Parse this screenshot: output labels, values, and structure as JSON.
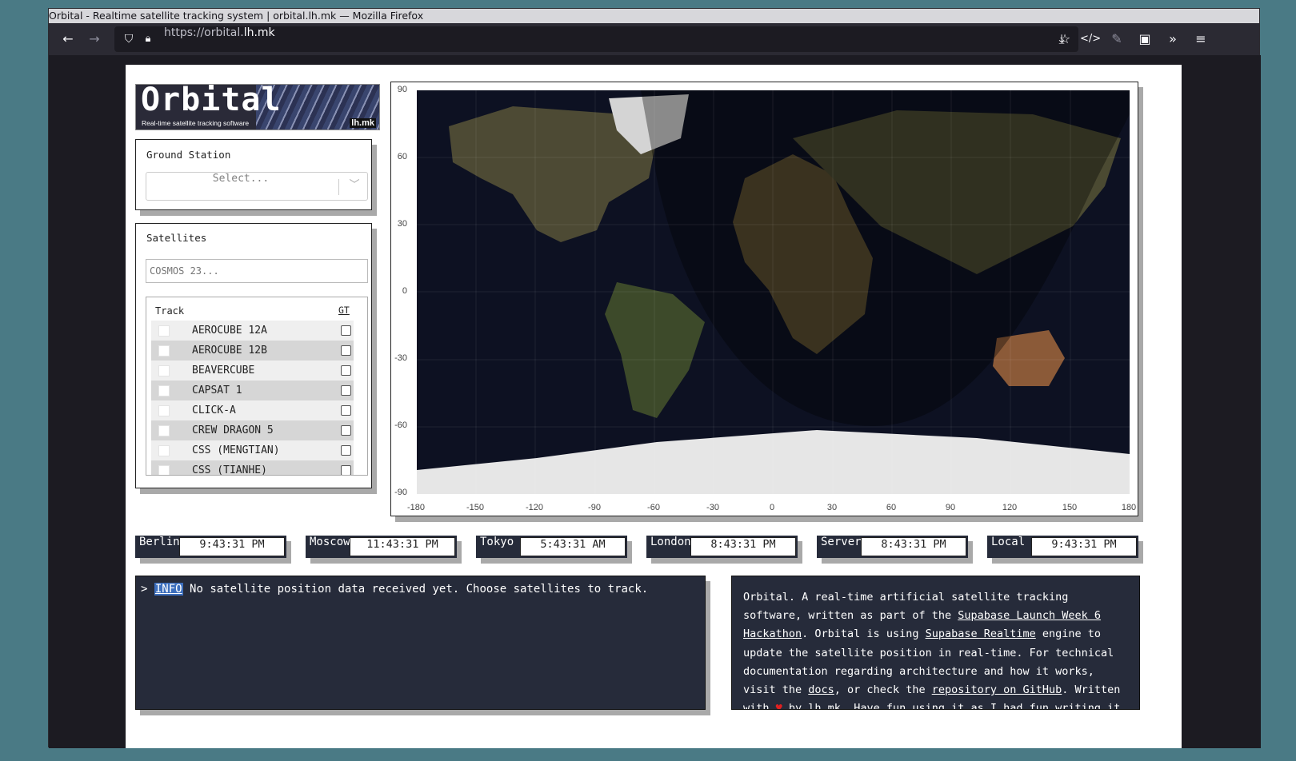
{
  "window": {
    "title": "Orbital - Realtime satellite tracking system | orbital.lh.mk — Mozilla Firefox",
    "url_prefix": "https://orbital.",
    "url_domain": "lh.mk"
  },
  "logo": {
    "title": "Orbital",
    "subtitle": "Real-time satellite tracking software",
    "tag": "lh.mk"
  },
  "ground_station": {
    "label": "Ground Station",
    "placeholder": "Select..."
  },
  "satellites": {
    "label": "Satellites",
    "search_placeholder": "COSMOS 23...",
    "col_track": "Track",
    "col_gt": "GT",
    "rows": [
      {
        "name": "AEROCUBE 12A"
      },
      {
        "name": "AEROCUBE 12B"
      },
      {
        "name": "BEAVERCUBE"
      },
      {
        "name": "CAPSAT 1"
      },
      {
        "name": "CLICK-A"
      },
      {
        "name": "CREW DRAGON 5"
      },
      {
        "name": "CSS (MENGTIAN)"
      },
      {
        "name": "CSS (TIANHE)"
      }
    ]
  },
  "map": {
    "y_ticks": [
      "90",
      "60",
      "30",
      "0",
      "-30",
      "-60",
      "-90"
    ],
    "x_ticks": [
      "-180",
      "-150",
      "-120",
      "-90",
      "-60",
      "-30",
      "0",
      "30",
      "60",
      "90",
      "120",
      "150",
      "180"
    ]
  },
  "clocks": [
    {
      "city": "Berlin",
      "time": "9:43:31 PM"
    },
    {
      "city": "Moscow",
      "time": "11:43:31 PM"
    },
    {
      "city": "Tokyo",
      "time": "5:43:31 AM"
    },
    {
      "city": "London",
      "time": "8:43:31 PM"
    },
    {
      "city": "Server",
      "time": "8:43:31 PM"
    },
    {
      "city": "Local",
      "time": "9:43:31 PM"
    }
  ],
  "console": {
    "prompt": ">",
    "level": "INFO",
    "message": "No satellite position data received yet. Choose satellites to track."
  },
  "about": {
    "t1": "Orbital. A real-time artificial satellite tracking software, written as part of the ",
    "link1": "Supabase Launch Week 6 Hackathon",
    "t2": ". Orbital is using ",
    "link2": "Supabase Realtime",
    "t3": " engine to update the satellite position in real-time. For technical documentation regarding architecture and how it works, visit the ",
    "link3": "docs",
    "t4": ", or check the ",
    "link4": "repository on GitHub",
    "t5": ". Written with ",
    "heart": "♥",
    "t6": " by ",
    "link5": "lh.mk",
    "t7": ". Have fun using it as I had fun writing it. :)"
  },
  "colors": {
    "panel_dark": "#262b3a",
    "shadow": "#a9a9a9",
    "info_highlight": "#3d6fbd"
  }
}
